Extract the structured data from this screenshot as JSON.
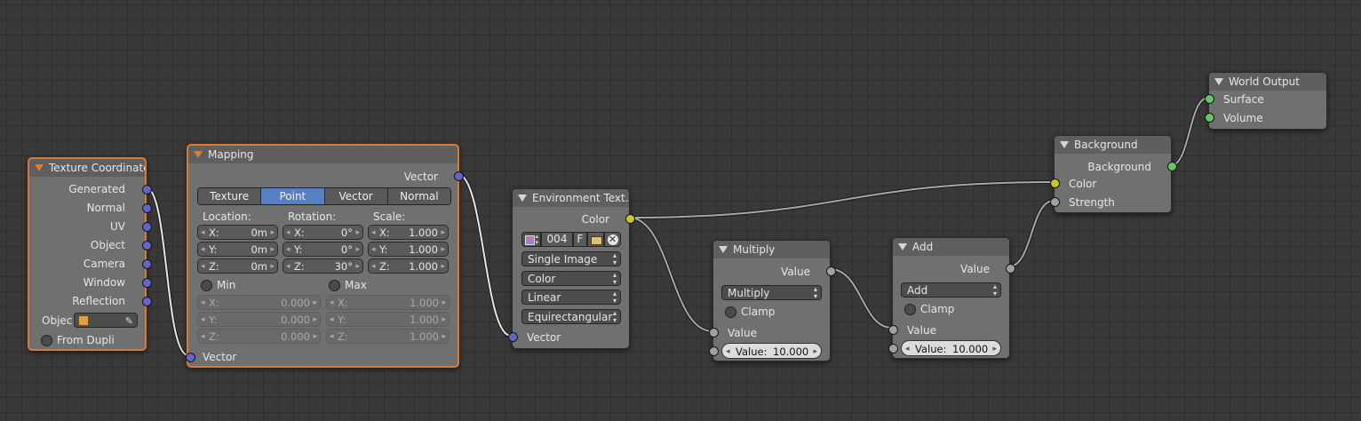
{
  "nodes": {
    "texcoord": {
      "title": "Texture Coordinate",
      "outputs": [
        "Generated",
        "Normal",
        "UV",
        "Object",
        "Camera",
        "Window",
        "Reflection"
      ],
      "object_label": "Objec",
      "from_dupli": "From Dupli"
    },
    "mapping": {
      "title": "Mapping",
      "output": "Vector",
      "modes": [
        "Texture",
        "Point",
        "Vector",
        "Normal"
      ],
      "active_mode": "Point",
      "location_label": "Location:",
      "rotation_label": "Rotation:",
      "scale_label": "Scale:",
      "location": {
        "x": "0m",
        "y": "0m",
        "z": "0m"
      },
      "rotation": {
        "x": "0°",
        "y": "0°",
        "z": "30°"
      },
      "scale": {
        "x": "1.000",
        "y": "1.000",
        "z": "1.000"
      },
      "axis": {
        "x": "X:",
        "y": "Y:",
        "z": "Z:"
      },
      "min_label": "Min",
      "max_label": "Max",
      "min": {
        "x": "0.000",
        "y": "0.000",
        "z": "0.000"
      },
      "max": {
        "x": "1.000",
        "y": "1.000",
        "z": "1.000"
      },
      "input": "Vector"
    },
    "envtex": {
      "title": "Environment Text...",
      "output": "Color",
      "image_name": "004",
      "fake_user": "F",
      "projection_source": "Single Image",
      "color_space": "Color",
      "interpolation": "Linear",
      "projection": "Equirectangular",
      "input": "Vector"
    },
    "multiply": {
      "title": "Multiply",
      "output": "Value",
      "operation": "Multiply",
      "clamp": "Clamp",
      "input_label": "Value",
      "value_field": "Value:",
      "value": "10.000"
    },
    "add": {
      "title": "Add",
      "output": "Value",
      "operation": "Add",
      "clamp": "Clamp",
      "input_label": "Value",
      "value_field": "Value:",
      "value": "10.000"
    },
    "background": {
      "title": "Background",
      "output": "Background",
      "inputs": [
        "Color",
        "Strength"
      ]
    },
    "world_output": {
      "title": "World Output",
      "inputs": [
        "Surface",
        "Volume"
      ]
    }
  },
  "colors": {
    "vector_socket": "#6363c8",
    "color_socket": "#c8c829",
    "value_socket": "#a1a1a1",
    "shader_socket": "#63c763",
    "selected_outline": "#d87a30",
    "active_button": "#5680c2"
  },
  "icons": {
    "image_browse": "image-browse-icon",
    "open_file": "folder-icon",
    "unlink": "close-icon",
    "object": "cube-icon",
    "eyedropper": "eyedropper-icon"
  }
}
